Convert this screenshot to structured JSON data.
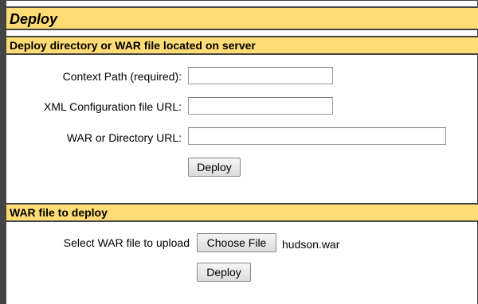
{
  "panel": {
    "title": "Deploy"
  },
  "server_section": {
    "header": "Deploy directory or WAR file located on server",
    "context_path_label": "Context Path (required):",
    "context_path_value": "",
    "xml_config_label": "XML Configuration file URL:",
    "xml_config_value": "",
    "war_dir_label": "WAR or Directory URL:",
    "war_dir_value": "",
    "deploy_label": "Deploy"
  },
  "upload_section": {
    "header": "WAR file to deploy",
    "select_label": "Select WAR file to upload",
    "choose_file_label": "Choose File",
    "selected_file": "hudson.war",
    "deploy_label": "Deploy"
  },
  "colors": {
    "header_bg": "#ffdc75",
    "border": "#444444"
  }
}
